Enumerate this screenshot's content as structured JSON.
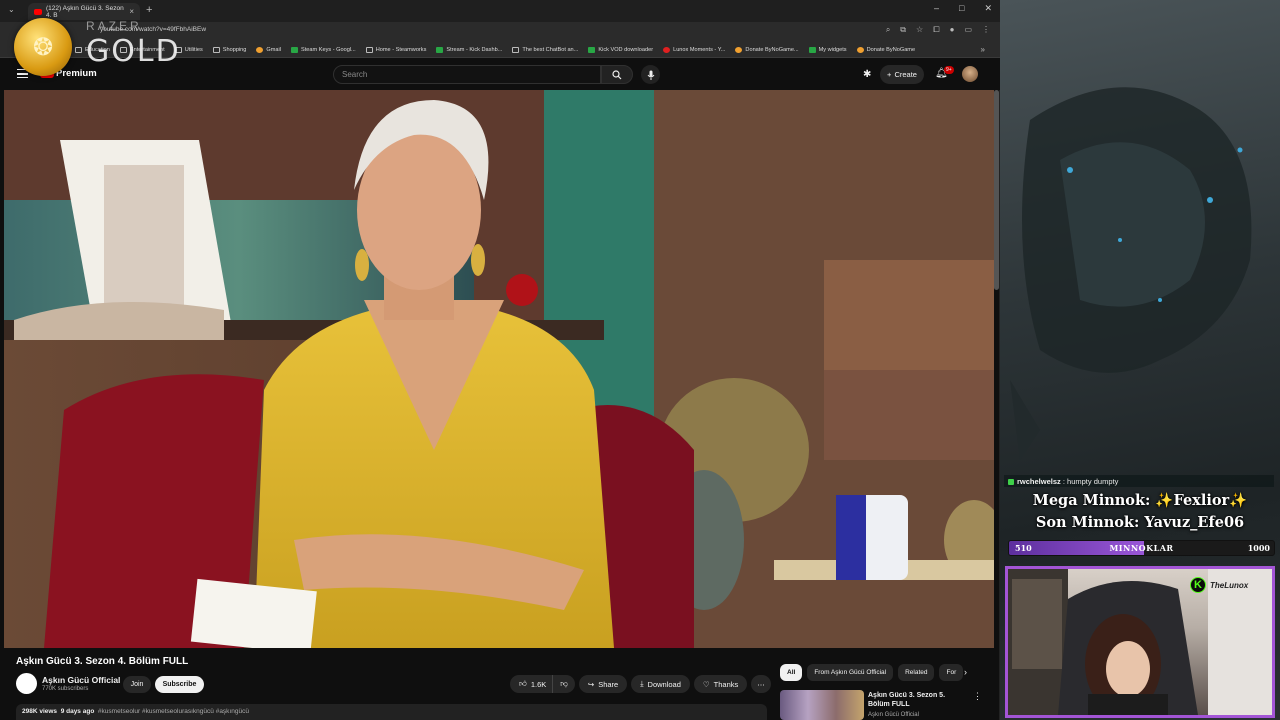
{
  "browser": {
    "tab_title": "(122) Aşkın Gücü 3. Sezon 4. B",
    "url": "youtube.com/watch?v=49fFbhAiBEw",
    "bookmarks": [
      "Education",
      "Entertainment",
      "Utilities",
      "Shopping",
      "Gmail",
      "Steam Keys - Googl...",
      "Home - Steamworks",
      "Stream - Kick Dashb...",
      "The best ChatBot an...",
      "Kick VOD downloader",
      "Lunox Moments - Y...",
      "Donate ByNoGame...",
      "My widgets",
      "Donate ByNoGame"
    ]
  },
  "overlay": {
    "brand": "RAZER",
    "tier": "GOLD"
  },
  "youtube": {
    "logo_text": "Premium",
    "search_placeholder": "Search",
    "create_label": "Create",
    "notif_badge": "9+",
    "video": {
      "title": "Aşkın Gücü 3. Sezon 4. Bölüm FULL",
      "channel": "Aşkın Gücü Official",
      "subscribers": "770K subscribers",
      "join_label": "Join",
      "subscribe_label": "Subscribe",
      "likes": "1.6K",
      "share_label": "Share",
      "download_label": "Download",
      "thanks_label": "Thanks",
      "views": "298K views",
      "age": "9 days ago",
      "hashtags": "#kusmetseolur #kusmetseolurasıkngücü #aşkıngücü"
    },
    "chips": [
      "All",
      "From Aşkın Gücü Official",
      "Related",
      "For"
    ],
    "recommendation": {
      "title": "Aşkın Gücü 3. Sezon 5. Bölüm FULL",
      "channel": "Aşkın Gücü Official"
    }
  },
  "stream": {
    "chat": {
      "nick": "rwchelwelsz",
      "message": "humpty dumpty"
    },
    "minnok_line1": "Mega Minnok: ✨Fexlior✨",
    "minnok_line2": "Son Minnok: Yavuz_Efe06",
    "goal": {
      "min": "510",
      "label": "MINNOKLAR",
      "max": "1000",
      "progress": 0.51
    },
    "kick_name": "TheLunox"
  },
  "colors": {
    "youtube_red": "#ff0000",
    "goal_purple": "#9a57d8",
    "kick_green": "#53fc18"
  }
}
